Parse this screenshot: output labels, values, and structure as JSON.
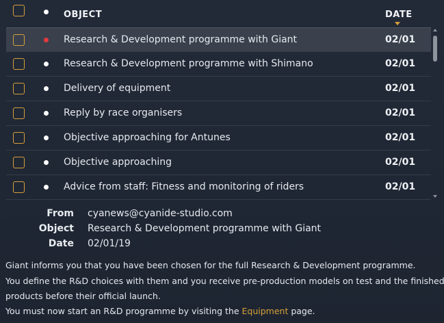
{
  "header": {
    "object_label": "OBJECT",
    "date_label": "DATE"
  },
  "messages": [
    {
      "object": "Research & Development programme with Giant",
      "date": "02/01",
      "dot_color": "#e0393c",
      "selected": true
    },
    {
      "object": "Research & Development programme with Shimano",
      "date": "02/01",
      "dot_color": "#ffffff",
      "selected": false
    },
    {
      "object": "Delivery of equipment",
      "date": "02/01",
      "dot_color": "#ffffff",
      "selected": false
    },
    {
      "object": "Reply by race organisers",
      "date": "02/01",
      "dot_color": "#ffffff",
      "selected": false
    },
    {
      "object": "Objective approaching for Antunes",
      "date": "02/01",
      "dot_color": "#ffffff",
      "selected": false
    },
    {
      "object": "Objective approaching",
      "date": "02/01",
      "dot_color": "#ffffff",
      "selected": false
    },
    {
      "object": "Advice from staff: Fitness and monitoring of riders",
      "date": "02/01",
      "dot_color": "#ffffff",
      "selected": false
    }
  ],
  "detail": {
    "from_label": "From",
    "from_value": "cyanews@cyanide-studio.com",
    "object_label": "Object",
    "object_value": "Research & Development programme with Giant",
    "date_label": "Date",
    "date_value": "02/01/19"
  },
  "body": {
    "line1": "Giant informs you that you have been chosen for the full Research & Development programme.",
    "line2": "You define the R&D choices with them and you receive pre-production models on test and the finished",
    "line3": "products before their official launch.",
    "line4_prefix": "You must now start an R&D programme by visiting the ",
    "line4_link": "Equipment",
    "line4_suffix": " page."
  },
  "colors": {
    "accent": "#d7a03a",
    "unread_dot": "#e0393c",
    "read_dot": "#ffffff",
    "background": "#222a38"
  }
}
